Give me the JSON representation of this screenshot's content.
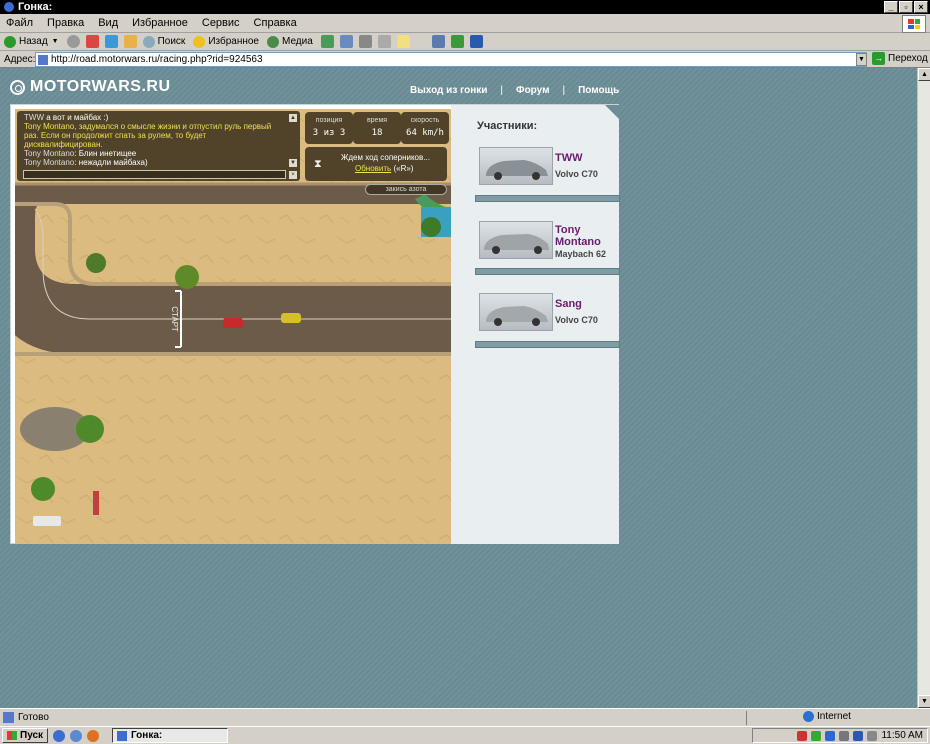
{
  "window": {
    "title": "Гонка:"
  },
  "menu": [
    "Файл",
    "Правка",
    "Вид",
    "Избранное",
    "Сервис",
    "Справка"
  ],
  "toolbar": {
    "back": "Назад",
    "search": "Поиск",
    "favorites": "Избранное",
    "media": "Медиа"
  },
  "address": {
    "label": "Адрес:",
    "url": "http://road.motorwars.ru/racing.php?rid=924563",
    "go": "Переход"
  },
  "site": {
    "logo": "MOTORWARS.RU",
    "nav": [
      "Выход из гонки",
      "Форум",
      "Помощь"
    ]
  },
  "chat": {
    "lines": [
      {
        "user": "TWW",
        "text": "а вот и майбах :)",
        "style": "user"
      },
      {
        "user": "",
        "text": "Tony Montano, задумался о смысле жизни и отпустил руль первый раз. Если он продолжит спать за рулем, то будет дисквалифицирован.",
        "style": "system"
      },
      {
        "user": "Tony Montano",
        "text": "Блин инетищее",
        "style": "user"
      },
      {
        "user": "Tony Montano",
        "text": "нежадли майбаха)",
        "style": "user"
      }
    ]
  },
  "hud": {
    "position_label": "позиция",
    "position_value": "3 из 3",
    "time_label": "время",
    "time_value": "18",
    "speed_label": "скорость",
    "speed_value": "64 km/h",
    "wait_text": "Ждем ход соперников...",
    "refresh_link": "Обновить",
    "refresh_key": "(«R»)",
    "nitro": "закись азота",
    "start_label": "СТАРТ"
  },
  "participants": {
    "title": "Участники:",
    "list": [
      {
        "name": "TWW",
        "car": "Volvo C70"
      },
      {
        "name": "Tony Montano",
        "car": "Maybach 62"
      },
      {
        "name": "Sang",
        "car": "Volvo C70"
      }
    ]
  },
  "status": {
    "text": "Готово",
    "zone": "Internet"
  },
  "taskbar": {
    "start": "Пуск",
    "task": "Гонка:",
    "clock": "11:50 AM"
  },
  "colors": {
    "page_bg": "#6d8e98",
    "name_color": "#6a1b6d",
    "sand": "#d9b67c",
    "road": "#6b5b48"
  }
}
